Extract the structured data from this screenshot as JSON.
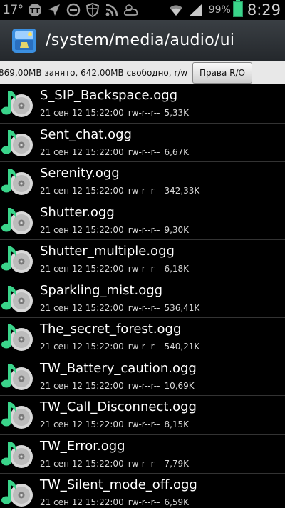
{
  "status_bar": {
    "temperature": "17°",
    "battery_percent": "99%",
    "time": "8:29",
    "icons": [
      "tt-icon",
      "navigation-arrow-icon",
      "do-not-disturb-icon",
      "shield-icon",
      "rss-icon",
      "weather-cloud-icon",
      "wifi-icon",
      "signal-icon",
      "battery-icon"
    ]
  },
  "titlebar": {
    "path": "/system/media/audio/ui"
  },
  "infobar": {
    "storage_text": "869,00MB занято, 642,00MB свободно, r/w",
    "rights_button": "Права R/O"
  },
  "colors": {
    "accent_green": "#3ad48a",
    "background": "#000000",
    "infobar_bg": "#e8e8e8"
  },
  "files": [
    {
      "name": "S_SIP_Backspace.ogg",
      "date": "21 сен 12 15:22:00",
      "perms": "rw-r--r--",
      "size": "5,33K"
    },
    {
      "name": "Sent_chat.ogg",
      "date": "21 сен 12 15:22:00",
      "perms": "rw-r--r--",
      "size": "6,67K"
    },
    {
      "name": "Serenity.ogg",
      "date": "21 сен 12 15:22:00",
      "perms": "rw-r--r--",
      "size": "342,33K"
    },
    {
      "name": "Shutter.ogg",
      "date": "21 сен 12 15:22:00",
      "perms": "rw-r--r--",
      "size": "9,30K"
    },
    {
      "name": "Shutter_multiple.ogg",
      "date": "21 сен 12 15:22:00",
      "perms": "rw-r--r--",
      "size": "6,18K"
    },
    {
      "name": "Sparkling_mist.ogg",
      "date": "21 сен 12 15:22:00",
      "perms": "rw-r--r--",
      "size": "536,41K"
    },
    {
      "name": "The_secret_forest.ogg",
      "date": "21 сен 12 15:22:00",
      "perms": "rw-r--r--",
      "size": "540,21K"
    },
    {
      "name": "TW_Battery_caution.ogg",
      "date": "21 сен 12 15:22:00",
      "perms": "rw-r--r--",
      "size": "10,69K"
    },
    {
      "name": "TW_Call_Disconnect.ogg",
      "date": "21 сен 12 15:22:00",
      "perms": "rw-r--r--",
      "size": "8,15K"
    },
    {
      "name": "TW_Error.ogg",
      "date": "21 сен 12 15:22:00",
      "perms": "rw-r--r--",
      "size": "7,79K"
    },
    {
      "name": "TW_Silent_mode_off.ogg",
      "date": "21 сен 12 15:22:00",
      "perms": "rw-r--r--",
      "size": "6,59K"
    }
  ]
}
